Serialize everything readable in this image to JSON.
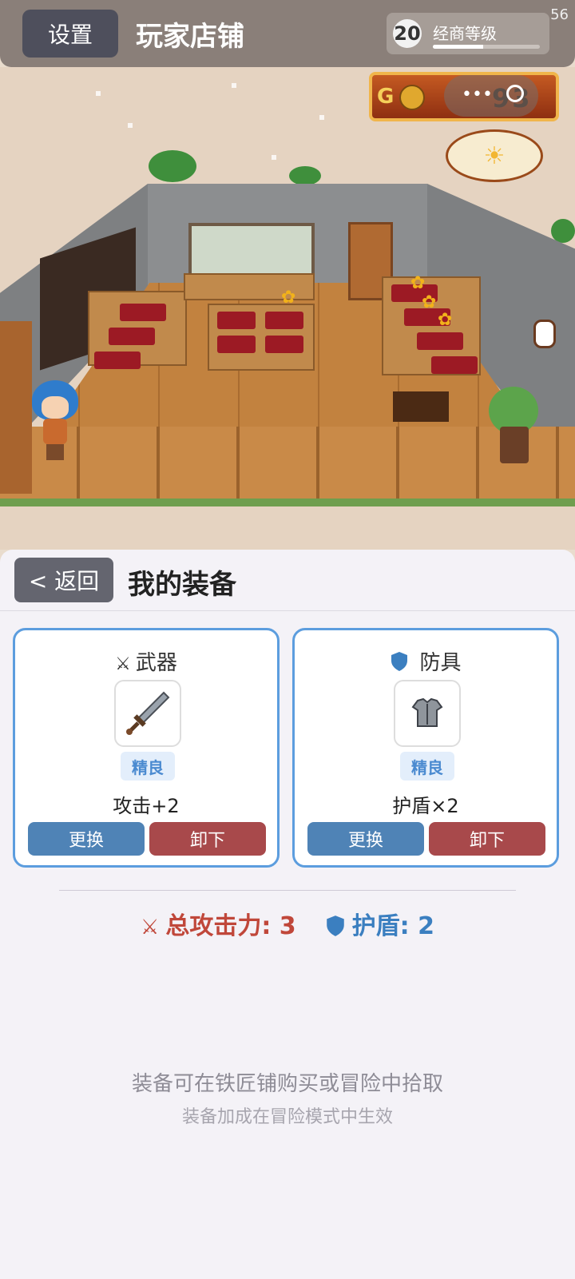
{
  "header": {
    "settings_label": "设置",
    "title": "玩家店铺",
    "level": {
      "value": "20",
      "label": "经商等级",
      "progress": 0.47
    },
    "corner_number": "56"
  },
  "scene": {
    "gold_prefix": "G",
    "gold_value": "93",
    "weather": "sunny-cloudy"
  },
  "panel": {
    "back_label": "< 返回",
    "title": "我的装备",
    "weapon": {
      "icon": "crossed-swords-icon",
      "label": "武器",
      "item_icon": "sword-icon",
      "rarity": "精良",
      "stat": "攻击+2",
      "swap_label": "更换",
      "remove_label": "卸下"
    },
    "armor": {
      "icon": "shield-icon",
      "label": "防具",
      "item_icon": "chestplate-icon",
      "rarity": "精良",
      "stat": "护盾×2",
      "swap_label": "更换",
      "remove_label": "卸下"
    },
    "totals": {
      "attack_label": "总攻击力: 3",
      "shield_label": "护盾: 2"
    },
    "hint_primary": "装备可在铁匠铺购买或冒险中拾取",
    "hint_secondary": "装备加成在冒险模式中生效"
  },
  "colors": {
    "accent_blue": "#5c9dde",
    "swap_button": "#4f83b6",
    "remove_button": "#a8494b",
    "attack_total": "#c0473a",
    "shield_total": "#3b7fc0"
  }
}
